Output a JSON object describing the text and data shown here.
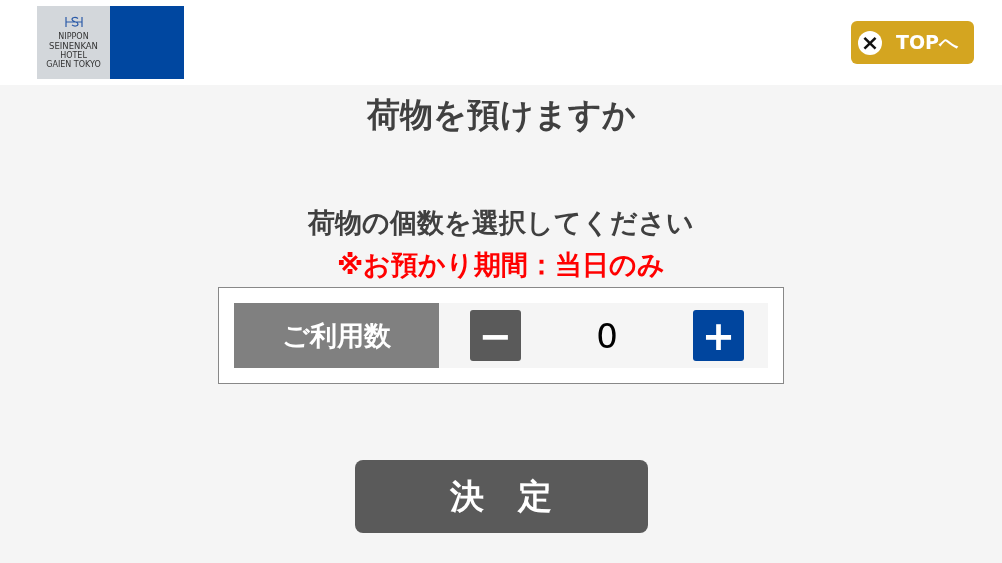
{
  "logo": {
    "lines": [
      "NIPPON",
      "SEINENKAN",
      "HOTEL",
      "GAIEN TOKYO"
    ]
  },
  "top_button": {
    "icon": "×",
    "label": "TOPへ"
  },
  "title": "荷物を預けますか",
  "instruction": "荷物の個数を選択してください",
  "notice": "※お預かり期間：当日のみ",
  "counter": {
    "label": "ご利用数",
    "minus": "−",
    "value": "0",
    "plus": "+"
  },
  "confirm_button": "決　定"
}
